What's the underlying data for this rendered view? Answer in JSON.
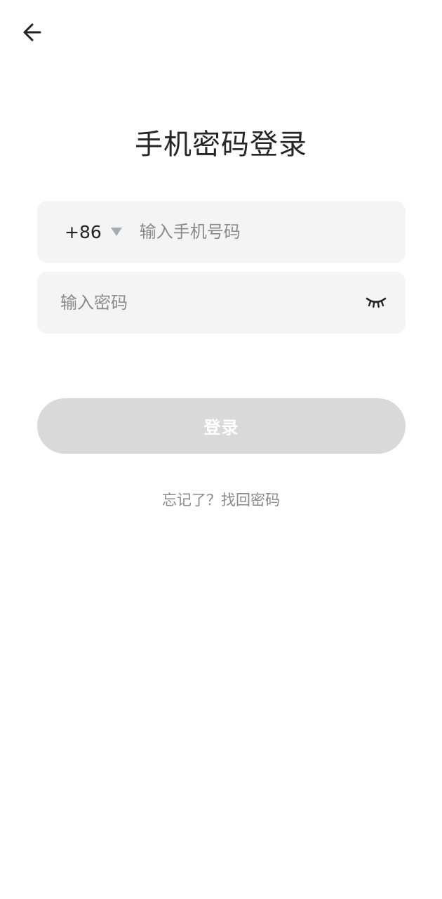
{
  "header": {
    "back_icon": "arrow-left-icon",
    "title": "手机密码登录"
  },
  "phone_field": {
    "country_code": "+86",
    "caret_icon": "triangle-down-icon",
    "value": "",
    "placeholder": "输入手机号码"
  },
  "password_field": {
    "value": "",
    "placeholder": "输入密码",
    "visibility_icon": "eye-closed-icon"
  },
  "login_button": {
    "label": "登录",
    "disabled": true
  },
  "links": {
    "forgot_prefix": "忘记了？",
    "forgot_action": "找回密码"
  },
  "colors": {
    "field_background": "#f4f4f4",
    "button_disabled": "#d9d9d9",
    "placeholder": "#8a8a8a",
    "caret": "#a9a9b3"
  }
}
